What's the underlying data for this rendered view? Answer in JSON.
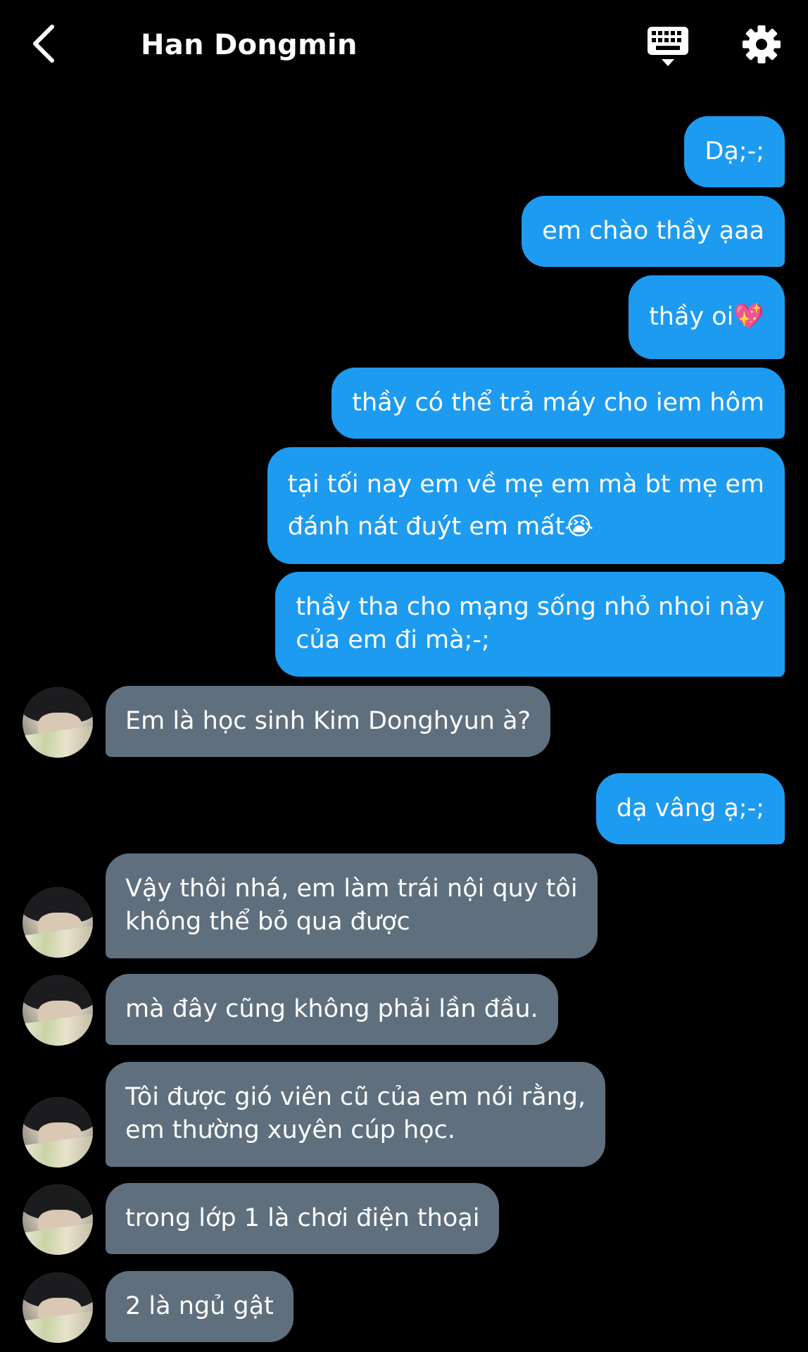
{
  "header": {
    "title": "Han Dongmin",
    "icons": {
      "back": "chevron-left-icon",
      "keyboard": "keyboard-icon",
      "settings": "gear-icon"
    }
  },
  "colors": {
    "background": "#000000",
    "outgoing_bubble": "#1d9bf0",
    "incoming_bubble": "#5f6f7e",
    "text": "#ffffff"
  },
  "messages": [
    {
      "from": "me",
      "lines": [
        "Dạ;-;"
      ]
    },
    {
      "from": "me",
      "lines": [
        "em chào thầy ạaa"
      ]
    },
    {
      "from": "me",
      "lines": [
        "thầy oi💖"
      ]
    },
    {
      "from": "me",
      "lines": [
        "thầy có thể trả máy cho iem hôm"
      ]
    },
    {
      "from": "me",
      "lines": [
        "tại tối nay em về mẹ em mà bt mẹ em",
        "đánh nát đuýt em mất😭"
      ]
    },
    {
      "from": "me",
      "lines": [
        "thầy tha cho mạng sống nhỏ nhoi này",
        "của em đi mà;-;"
      ]
    },
    {
      "from": "them",
      "lines": [
        "Em là học sinh Kim Donghyun à?"
      ]
    },
    {
      "from": "me",
      "lines": [
        "dạ vâng ạ;-;"
      ]
    },
    {
      "from": "them",
      "lines": [
        "Vậy thôi nhá, em làm trái nội quy tôi",
        "không thể bỏ qua được"
      ]
    },
    {
      "from": "them",
      "lines": [
        "mà đây cũng không phải lần đầu."
      ]
    },
    {
      "from": "them",
      "lines": [
        "Tôi được gió viên cũ của em nói rằng,",
        "em thường xuyên cúp học."
      ]
    },
    {
      "from": "them",
      "lines": [
        "trong lớp 1 là chơi điện thoại"
      ]
    },
    {
      "from": "them",
      "lines": [
        "2 là ngủ gật"
      ]
    }
  ]
}
